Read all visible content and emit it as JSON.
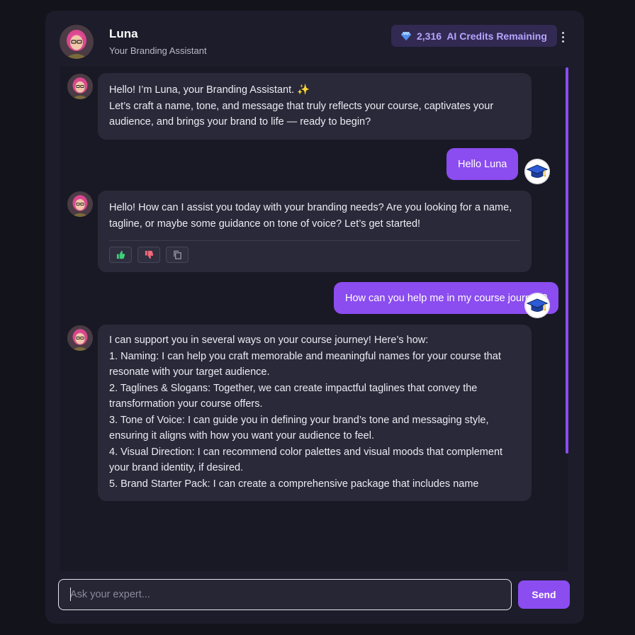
{
  "header": {
    "assistant_name": "Luna",
    "assistant_role": "Your Branding Assistant",
    "credits_count": "2,316",
    "credits_label": "AI Credits Remaining",
    "gem_icon": "diamond-icon",
    "menu_icon": "more-vertical-icon"
  },
  "messages": [
    {
      "sender": "assistant",
      "lines": [
        "Hello! I’m Luna, your Branding Assistant. ✨",
        "Let’s craft a name, tone, and message that truly reflects your course, captivates your audience, and brings your brand to life — ready to begin?"
      ]
    },
    {
      "sender": "user",
      "text": "Hello Luna"
    },
    {
      "sender": "assistant",
      "text": "Hello! How can I assist you today with your branding needs? Are you looking for a name, tagline, or maybe some guidance on tone of voice? Let’s get started!",
      "actions": [
        "thumbs-up-icon",
        "thumbs-down-icon",
        "copy-icon"
      ]
    },
    {
      "sender": "user",
      "text": "How can you help me in my course journey?"
    },
    {
      "sender": "assistant",
      "intro": "I can support you in several ways on your course journey! Here’s how:",
      "items": [
        "1. Naming: I can help you craft memorable and meaningful names for your course that resonate with your target audience.",
        "2. Taglines & Slogans: Together, we can create impactful taglines that convey the transformation your course offers.",
        "3. Tone of Voice: I can guide you in defining your brand’s tone and messaging style, ensuring it aligns with how you want your audience to feel.",
        "4. Visual Direction: I can recommend color palettes and visual moods that complement your brand identity, if desired.",
        "5. Brand Starter Pack: I can create a comprehensive package that includes name"
      ]
    }
  ],
  "composer": {
    "placeholder": "Ask your expert...",
    "send_label": "Send"
  },
  "colors": {
    "accent": "#8b4cf0",
    "background": "#13131c",
    "panel": "#1c1c2a",
    "bubble": "#292939"
  }
}
